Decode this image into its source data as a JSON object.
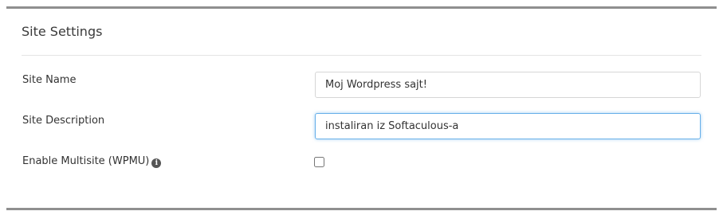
{
  "panel": {
    "title": "Site Settings"
  },
  "fields": {
    "site_name": {
      "label": "Site Name",
      "value": "Moj Wordpress sajt!"
    },
    "site_description": {
      "label": "Site Description",
      "value": "instaliran iz Softaculous-a"
    },
    "multisite": {
      "label": "Enable Multisite (WPMU)",
      "checked": false,
      "icon": "info-icon"
    }
  },
  "colors": {
    "border": "#8f8f8f",
    "focus": "#66afe9",
    "text": "#333333"
  }
}
